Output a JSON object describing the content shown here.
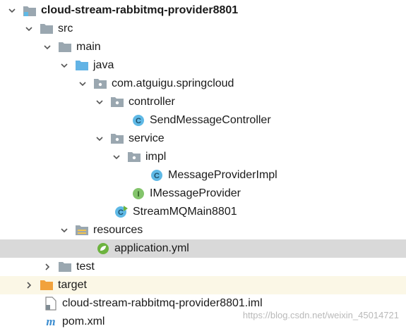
{
  "tree": {
    "root": {
      "label": "cloud-stream-rabbitmq-provider8801"
    },
    "src": {
      "label": "src"
    },
    "main": {
      "label": "main"
    },
    "java": {
      "label": "java"
    },
    "package": {
      "label": "com.atguigu.springcloud"
    },
    "controller": {
      "label": "controller"
    },
    "send_controller": {
      "label": "SendMessageController",
      "badge": "C"
    },
    "service": {
      "label": "service"
    },
    "impl": {
      "label": "impl"
    },
    "provider_impl": {
      "label": "MessageProviderImpl",
      "badge": "C"
    },
    "iprovider": {
      "label": "IMessageProvider",
      "badge": "I"
    },
    "main_class": {
      "label": "StreamMQMain8801",
      "badge": "C"
    },
    "resources": {
      "label": "resources"
    },
    "app_yml": {
      "label": "application.yml"
    },
    "test": {
      "label": "test"
    },
    "target": {
      "label": "target"
    },
    "iml": {
      "label": "cloud-stream-rabbitmq-provider8801.iml"
    },
    "pom": {
      "label": "pom.xml",
      "badge": "m"
    }
  },
  "watermark": "https://blog.csdn.net/weixin_45014721",
  "colors": {
    "selected_row": "#d9d9d9",
    "excluded_row": "#fbf7e6",
    "folder_gray": "#9aa7b0",
    "folder_blue": "#62b3e5",
    "folder_orange": "#f1a23c",
    "class_badge": "#5fb9e6",
    "interface_badge": "#83c46b",
    "spring_green": "#6db33f"
  }
}
